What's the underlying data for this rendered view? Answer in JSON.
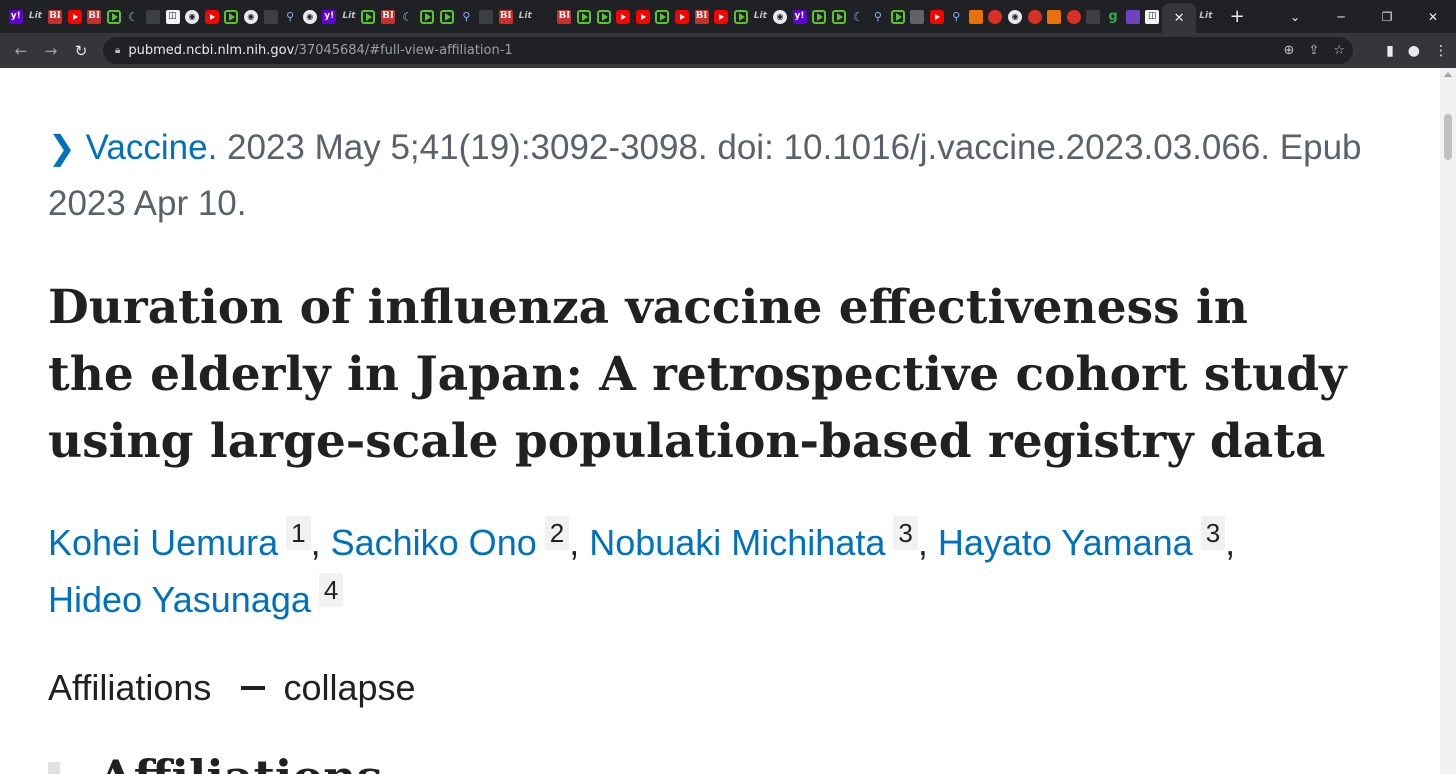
{
  "browser": {
    "tab_favicons": [
      "yahoo",
      "lit",
      "bi",
      "yt",
      "bi",
      "play",
      "moon",
      "dark",
      "white",
      "circ",
      "yt",
      "play",
      "circ",
      "dark",
      "search",
      "circ",
      "yahoo",
      "lit",
      "play",
      "bi",
      "moon",
      "play",
      "play",
      "search",
      "dark",
      "bi",
      "lit",
      "blank",
      "bi",
      "play",
      "play",
      "yt",
      "yt",
      "play",
      "yt",
      "bi",
      "yt",
      "play",
      "lit",
      "circ",
      "yahoo",
      "play",
      "play",
      "moon",
      "search",
      "play",
      "grey",
      "yt",
      "search",
      "orange",
      "red",
      "circ",
      "red",
      "orange",
      "red",
      "dark",
      "green",
      "purple",
      "white"
    ],
    "active_tab_close": "✕",
    "active_tab_icon_text": "Lit",
    "new_tab": "+",
    "window_controls": {
      "dropdown": "⌄",
      "minimize": "─",
      "restore": "❐",
      "close": "✕"
    },
    "url_host": "pubmed.ncbi.nlm.nih.gov",
    "url_path": "/37045684/#full-view-affiliation-1"
  },
  "article": {
    "journal": "Vaccine.",
    "citation_rest": " 2023 May 5;41(19):3092-3098. doi: 10.1016/j.vaccine.2023.03.066. Epub 2023 Apr 10.",
    "title": "Duration of influenza vaccine effectiveness in the elderly in Japan: A retrospective cohort study using large-scale population-based registry data",
    "authors": [
      {
        "name": "Kohei Uemura",
        "aff": "1"
      },
      {
        "name": "Sachiko Ono",
        "aff": "2"
      },
      {
        "name": "Nobuaki Michihata",
        "aff": "3"
      },
      {
        "name": "Hayato Yamana",
        "aff": "3"
      },
      {
        "name": "Hideo Yasunaga",
        "aff": "4"
      }
    ],
    "affiliations_label": "Affiliations",
    "affiliations_toggle": "collapse",
    "affiliations_heading": "Affiliations"
  }
}
